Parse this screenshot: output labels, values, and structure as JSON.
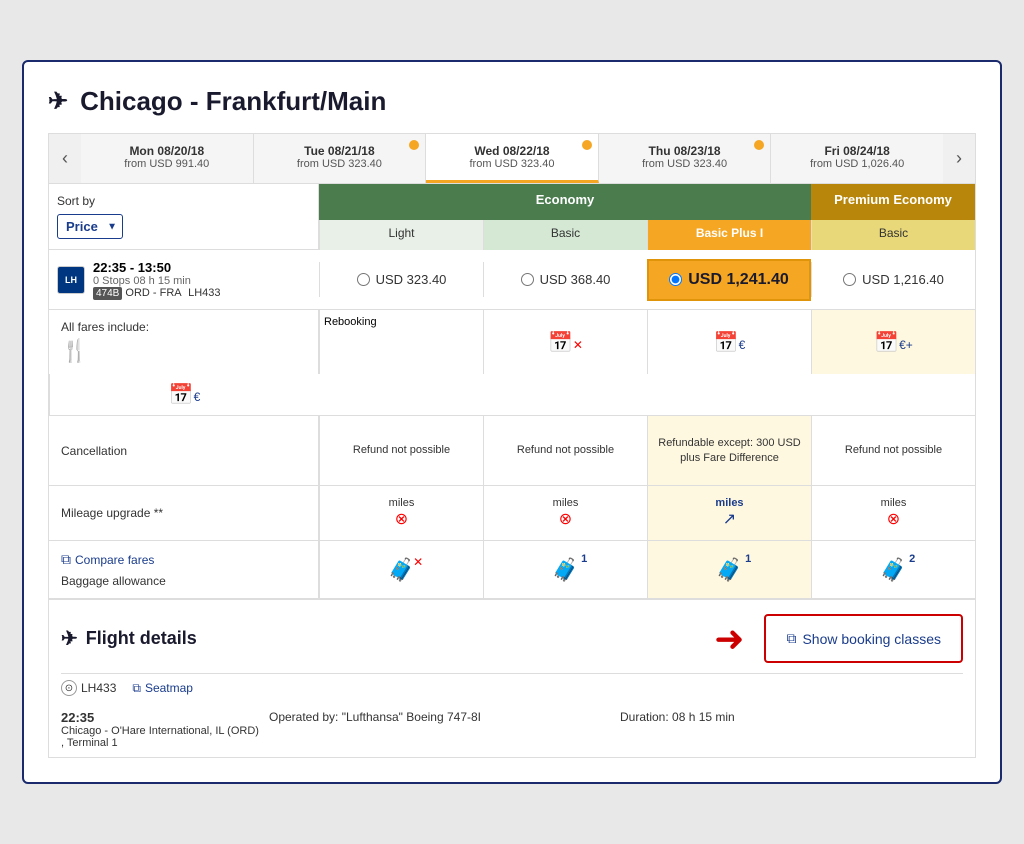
{
  "title": "Chicago - Frankfurt/Main",
  "dates": [
    {
      "label": "Mon 08/20/18",
      "price": "from USD 991.40",
      "active": false,
      "dot": false
    },
    {
      "label": "Tue 08/21/18",
      "price": "from USD 323.40",
      "active": false,
      "dot": true
    },
    {
      "label": "Wed 08/22/18",
      "price": "from USD 323.40",
      "active": true,
      "dot": true
    },
    {
      "label": "Thu 08/23/18",
      "price": "from USD 323.40",
      "active": false,
      "dot": true
    },
    {
      "label": "Fri 08/24/18",
      "price": "from USD 1,026.40",
      "active": false,
      "dot": false
    }
  ],
  "sort_label": "Sort by",
  "sort_value": "Price",
  "columns": {
    "economy_label": "Economy",
    "premium_economy_label": "Premium Economy",
    "light_label": "Light",
    "basic_label": "Basic",
    "basic_plus_label": "Basic Plus I",
    "prem_basic_label": "Basic"
  },
  "flight": {
    "time": "22:35 - 13:50",
    "stops": "0 Stops 08 h 15 min",
    "route": "ORD - FRA",
    "flight_num": "LH433",
    "badge": "474B"
  },
  "prices": {
    "light": "USD 323.40",
    "basic": "USD 368.40",
    "basic_plus": "USD 1,241.40",
    "prem_basic": "USD 1,216.40"
  },
  "features": {
    "rebooking_label": "Rebooking",
    "cancellation_label": "Cancellation",
    "mileage_label": "Mileage upgrade **",
    "baggage_label": "Baggage allowance",
    "cancellation_light": "Refund not possible",
    "cancellation_basic": "Refund not possible",
    "cancellation_plus": "Refundable except: 300 USD plus Fare Difference",
    "cancellation_prem": "Refund not possible"
  },
  "all_fares_label": "All fares include:",
  "compare_fares_label": "Compare fares",
  "flight_details_title": "Flight details",
  "show_booking_classes": "Show booking classes",
  "sub_flight": {
    "flight_num": "LH433",
    "seatmap": "Seatmap",
    "departure_time": "22:35",
    "departure_city": "Chicago - O'Hare International, IL (ORD) , Terminal 1",
    "operated": "Operated by: \"Lufthansa\" Boeing 747-8I",
    "duration": "Duration: 08 h 15 min"
  }
}
